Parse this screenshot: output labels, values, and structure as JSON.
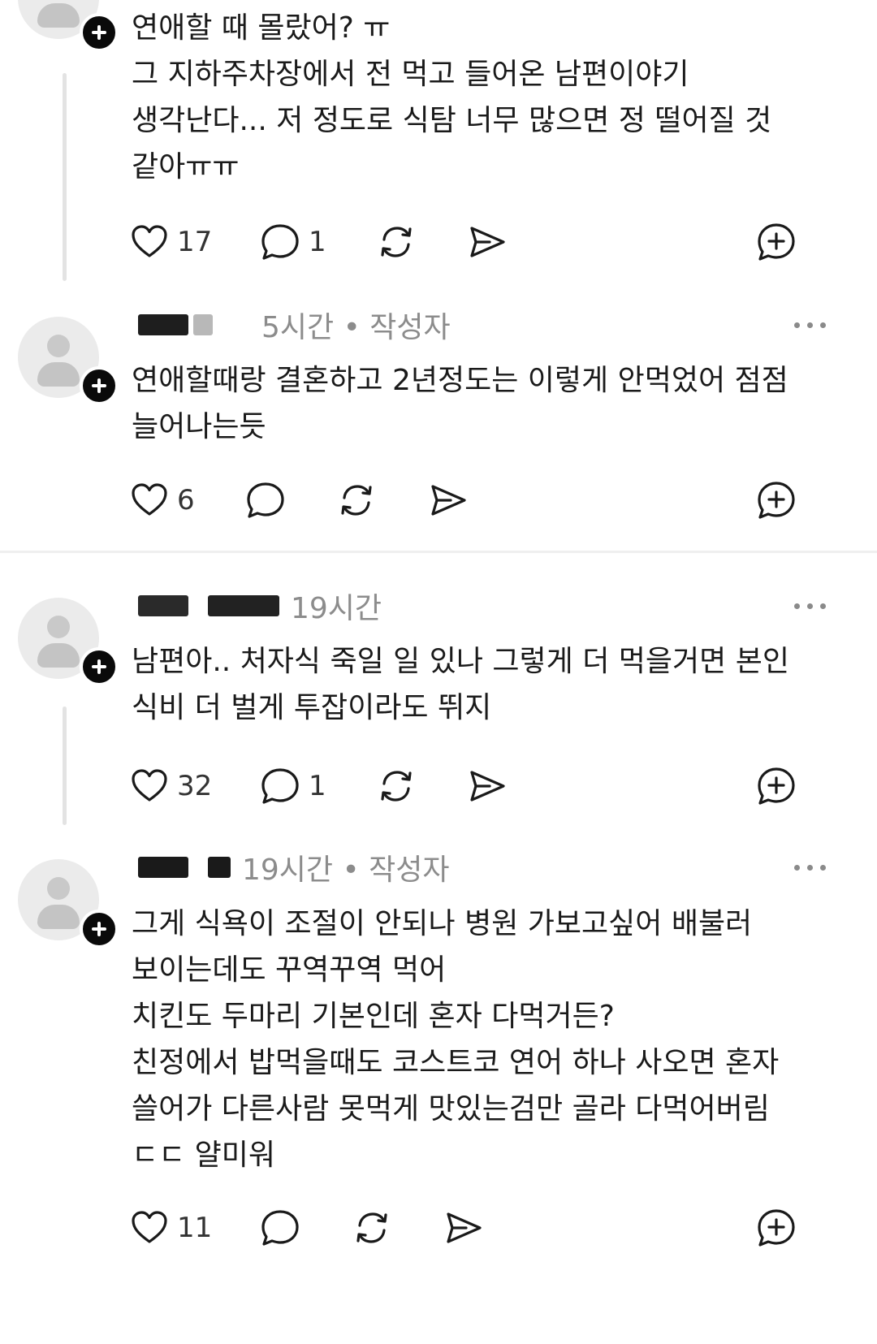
{
  "comments": [
    {
      "meta": "",
      "lines": [
        "연애할 때 몰랐어? ㅠ",
        "그 지하주차장에서 전 먹고 들어온 남편이야기",
        "생각난다... 저 정도로 식탐 너무 많으면 정 떨어질 것",
        "같아ㅠㅠ"
      ],
      "likes": "17",
      "replies": "1"
    },
    {
      "meta": "5시간 • 작성자",
      "lines": [
        "연애할때랑 결혼하고 2년정도는 이렇게 안먹었어 점점",
        "늘어나는듯"
      ],
      "likes": "6",
      "replies": ""
    },
    {
      "meta": "19시간",
      "lines": [
        "남편아.. 처자식 죽일 일 있나 그렇게 더 먹을거면 본인",
        "식비 더 벌게 투잡이라도 뛰지"
      ],
      "likes": "32",
      "replies": "1"
    },
    {
      "meta": "19시간 • 작성자",
      "lines": [
        "그게 식욕이 조절이 안되나 병원 가보고싶어 배불러",
        "보이는데도 꾸역꾸역 먹어",
        "치킨도 두마리 기본인데 혼자 다먹거든?",
        "친정에서 밥먹을때도 코스트코 연어 하나 사오면 혼자",
        "쓸어가 다른사람 못먹게  맛있는검만 골라 다먹어버림",
        "ㄷㄷ 얄미워"
      ],
      "likes": "11",
      "replies": ""
    }
  ],
  "icons": {
    "like": "heart-icon",
    "reply": "comment-icon",
    "repost": "repost-icon",
    "share": "send-icon",
    "quote": "quote-add-icon",
    "more": "more-icon",
    "follow": "plus-icon"
  }
}
